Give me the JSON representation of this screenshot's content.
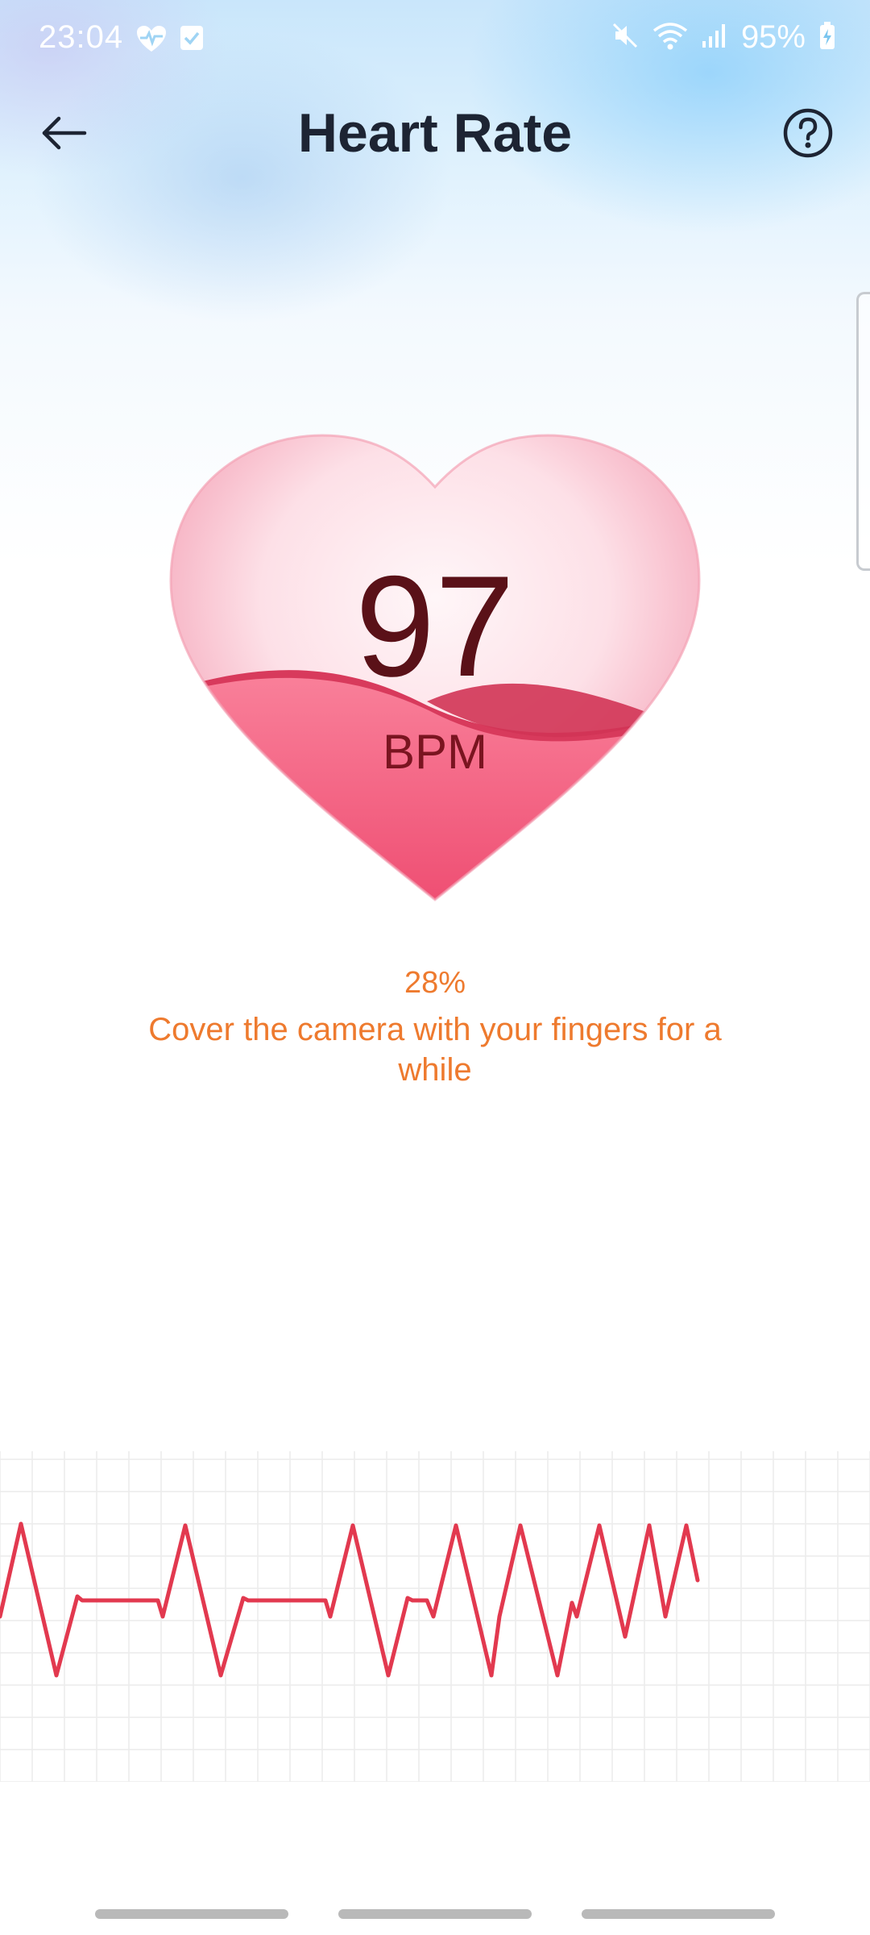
{
  "status_bar": {
    "time": "23:04",
    "battery": "95%",
    "icons": [
      "heart-monitor-icon",
      "check-box-icon",
      "mute-icon",
      "wifi-icon",
      "signal-icon",
      "battery-charging-icon"
    ]
  },
  "app_bar": {
    "title": "Heart Rate",
    "back_icon": "arrow-left-icon",
    "help_icon": "question-circle-icon"
  },
  "measurement": {
    "bpm": "97",
    "unit": "BPM",
    "progress_text": "28%",
    "progress_fraction": 0.28,
    "instruction": "Cover the camera with your fingers for a while"
  },
  "colors": {
    "accent_orange": "#ee7a2e",
    "heart_pink": "#f2607f",
    "ecg_line": "#e2394f",
    "title": "#1d2433"
  }
}
